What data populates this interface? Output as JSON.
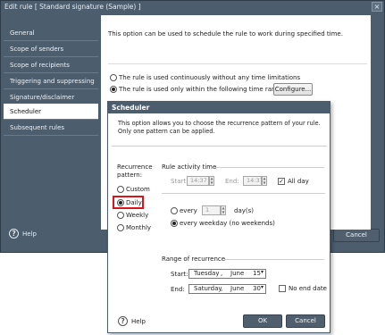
{
  "window": {
    "title": "Edit rule [ Standard signature (Sample) ]",
    "close_glyph": "×",
    "help_label": "Help",
    "cancel_label": "Cancel"
  },
  "sidebar": {
    "items": [
      {
        "label": "General"
      },
      {
        "label": "Scope of senders"
      },
      {
        "label": "Scope of recipients"
      },
      {
        "label": "Triggering and suppressing"
      },
      {
        "label": "Signature/disclaimer template"
      },
      {
        "label": "Scheduler",
        "active": true
      },
      {
        "label": "Subsequent rules"
      }
    ]
  },
  "main": {
    "description": "This option can be used to schedule the rule to work during specified time.",
    "option_continuous": "The rule is used continuously without any time limitations",
    "option_ranges": "The rule is used only within the following time ranges",
    "configure_label": "Configure..."
  },
  "dialog": {
    "title": "Scheduler",
    "description": "This option allows you to choose the recurrence pattern of your rule. Only one pattern can be applied.",
    "recurrence_label": "Recurrence pattern:",
    "patterns": [
      "Custom",
      "Daily",
      "Weekly",
      "Monthly"
    ],
    "selected_pattern": "Daily",
    "activity_time_label": "Rule activity time",
    "start_label": "Start:",
    "start_time": "14:37",
    "end_label": "End:",
    "end_time": "14:37",
    "all_day_label": "All day",
    "every_label": "every",
    "every_value": "1",
    "days_unit": "day(s)",
    "every_weekday_label": "every weekday (no weekends)",
    "range_label": "Range of recurrence",
    "range_start_label": "Start:",
    "range_start_weekday": "Tuesday",
    "range_start_sep": ",",
    "range_start_month": "June",
    "range_start_day": "15",
    "range_end_label": "End:",
    "range_end_weekday": "Saturday",
    "range_end_sep": ",",
    "range_end_month": "June",
    "range_end_day": "30",
    "no_end_label": "No end date",
    "help_label": "Help",
    "ok_label": "OK",
    "cancel_label": "Cancel"
  },
  "colors": {
    "frame": "#4c5d6e",
    "highlight": "#d9141b"
  },
  "icons": {
    "help": "help-circle-icon",
    "close": "close-icon",
    "spinner": "spinner-arrows-icon",
    "dropdown": "dropdown-arrow-icon"
  }
}
